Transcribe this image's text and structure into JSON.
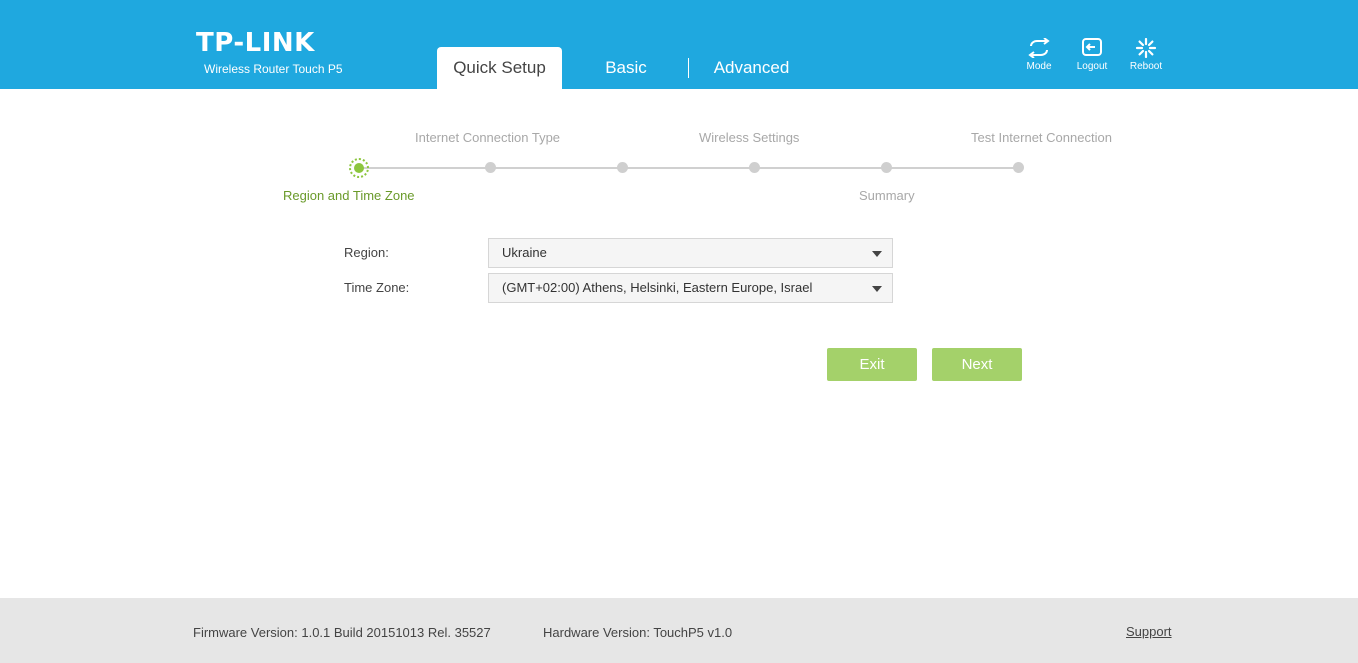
{
  "header": {
    "brand": "TP-LINK",
    "model": "Wireless Router Touch P5",
    "tabs": [
      {
        "label": "Quick Setup",
        "active": true
      },
      {
        "label": "Basic",
        "active": false
      },
      {
        "label": "Advanced",
        "active": false
      }
    ],
    "actions": [
      {
        "label": "Mode",
        "icon": "mode-icon"
      },
      {
        "label": "Logout",
        "icon": "logout-icon"
      },
      {
        "label": "Reboot",
        "icon": "reboot-icon"
      }
    ],
    "colors": {
      "header_bg": "#1fa8df",
      "accent_green": "#a4d16a"
    }
  },
  "steps": {
    "upper_labels": [
      "Internet Connection Type",
      "Wireless Settings",
      "Test Internet Connection"
    ],
    "lower_labels": [
      "Region and Time Zone",
      "Summary"
    ],
    "current_step": 1,
    "total_steps": 6
  },
  "form": {
    "region_label": "Region:",
    "region_value": "Ukraine",
    "timezone_label": "Time Zone:",
    "timezone_value": "(GMT+02:00) Athens, Helsinki, Eastern Europe, Israel"
  },
  "buttons": {
    "exit": "Exit",
    "next": "Next"
  },
  "footer": {
    "firmware": "Firmware Version: 1.0.1 Build 20151013 Rel. 35527",
    "hardware": "Hardware Version: TouchP5 v1.0",
    "support": "Support"
  }
}
